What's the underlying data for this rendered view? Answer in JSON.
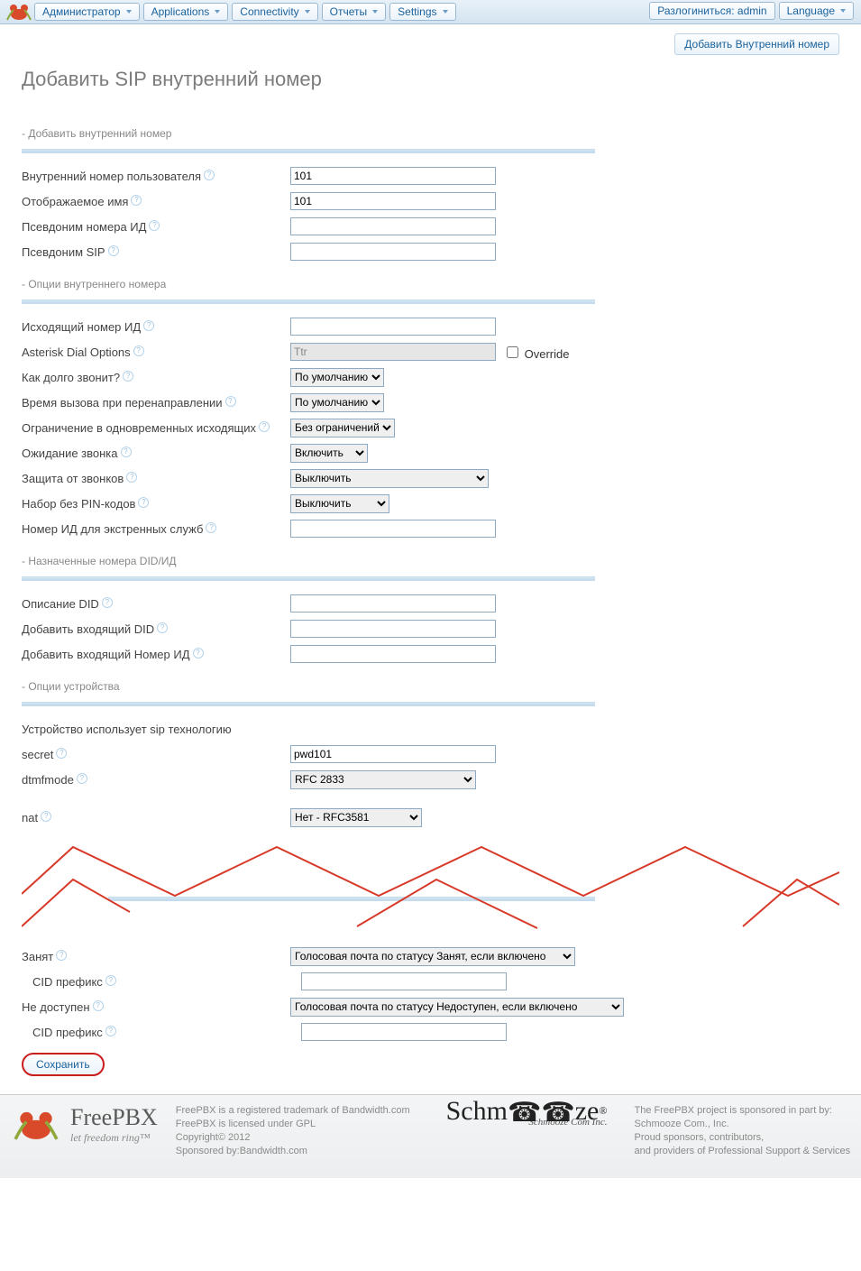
{
  "nav": {
    "admin": "Администратор",
    "apps": "Applications",
    "conn": "Connectivity",
    "reports": "Отчеты",
    "settings": "Settings",
    "logout": "Разлогиниться: admin",
    "lang": "Language"
  },
  "header": {
    "add_btn": "Добавить Внутренний номер",
    "title": "Добавить SIP внутренний номер"
  },
  "section_add": {
    "heading": "- Добавить внутренний номер",
    "ext_label": "Внутренний номер пользователя",
    "ext_value": "101",
    "disp_label": "Отображаемое имя",
    "disp_value": "101",
    "cidalias_label": "Псевдоним номера ИД",
    "sipalias_label": "Псевдоним SIP"
  },
  "section_opts": {
    "heading": "- Опции внутреннего номера",
    "out_cid_label": "Исходящий номер ИД",
    "dial_opts_label": "Asterisk Dial Options",
    "dial_opts_value": "Ttr",
    "override_label": "Override",
    "ringtime_label": "Как долго звонит?",
    "ringtime_value": "По умолчанию",
    "cfringtime_label": "Время вызова при перенаправлении",
    "cfringtime_value": "По умолчанию",
    "outlimit_label": "Ограничение в одновременных исходящих",
    "outlimit_value": "Без ограничений",
    "callwait_label": "Ожидание звонка",
    "callwait_value": "Включить",
    "screen_label": "Защита от звонков",
    "screen_value": "Выключить",
    "pinless_label": "Набор без PIN-кодов",
    "pinless_value": "Выключить",
    "emerg_label": "Номер ИД для экстренных служб"
  },
  "section_did": {
    "heading": "- Назначенные номера DID/ИД",
    "did_desc_label": "Описание DID",
    "did_add_label": "Добавить входящий DID",
    "cid_add_label": "Добавить входящий Номер ИД"
  },
  "section_dev": {
    "heading": "- Опции устройства",
    "tech_text": "Устройство использует sip технологию",
    "secret_label": "secret",
    "secret_value": "pwd101",
    "dtmf_label": "dtmfmode",
    "dtmf_value": "RFC 2833",
    "nat_label": "nat",
    "nat_value": "Нет - RFC3581"
  },
  "section_dest": {
    "busy_label": "Занят",
    "busy_value": "Голосовая почта по статусу Занят, если включено",
    "busy_pfx_label": "CID префикс",
    "unavail_label": "Не доступен",
    "unavail_value": "Голосовая почта по статусу Недоступен, если включено",
    "unavail_pfx_label": "CID префикс"
  },
  "submit_label": "Сохранить",
  "footer": {
    "l1": "FreePBX is a registered trademark of Bandwidth.com",
    "l2": "FreePBX is licensed under GPL",
    "l3": "Copyright© 2012",
    "l4": "Sponsored by:Bandwidth.com",
    "r1": "The FreePBX project is sponsored in part by:",
    "r2": "Schmooze Com., Inc.",
    "r3": "Proud sponsors, contributors,",
    "r4": "and providers of Professional Support & Services",
    "freepbx": "FreePBX",
    "tagline": "let freedom ring™",
    "schmooze": "Schm",
    "schmooze2": "ze",
    "schmooze_sub": "Schmooze Com Inc."
  }
}
